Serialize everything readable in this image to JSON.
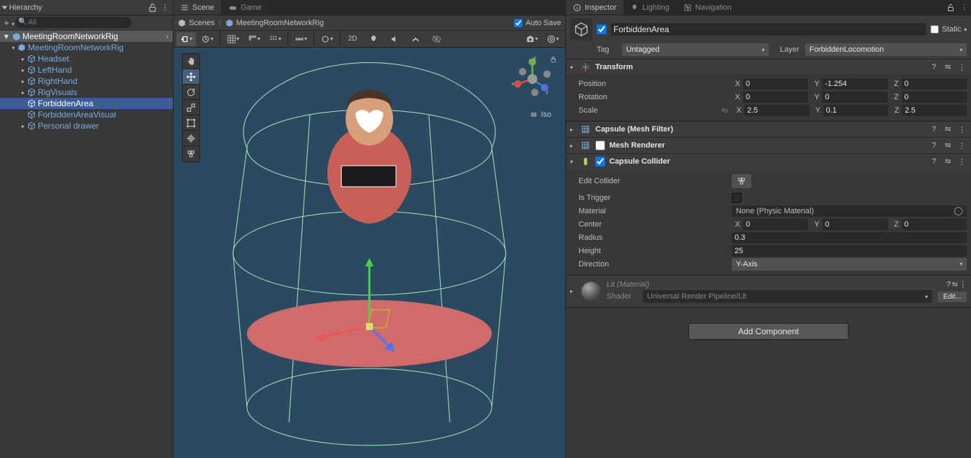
{
  "hierarchy": {
    "title": "Hierarchy",
    "search_placeholder": "All",
    "scene_name": "MeetingRoomNetworkRig",
    "root": "MeetingRoomNetworkRig",
    "nodes": {
      "headset": "Headset",
      "lefthand": "LeftHand",
      "righthand": "RightHand",
      "rigvisuals": "RigVisuals",
      "forbiddenarea": "ForbiddenArea",
      "forbiddenareavisual": "ForbiddenAreaVisual",
      "personaldrawer": "Personal drawer"
    }
  },
  "scene": {
    "tab_scene": "Scene",
    "tab_game": "Game",
    "bc_scenes": "Scenes",
    "bc_item": "MeetingRoomNetworkRig",
    "autosave": "Auto Save",
    "iso": "Iso",
    "twod": "2D",
    "axes": {
      "x": "x",
      "y": "y",
      "z": "z"
    }
  },
  "inspector": {
    "tab_inspector": "Inspector",
    "tab_lighting": "Lighting",
    "tab_navigation": "Navigation",
    "obj_name": "ForbiddenArea",
    "static_label": "Static",
    "tag_label": "Tag",
    "tag_value": "Untagged",
    "layer_label": "Layer",
    "layer_value": "ForbiddenLocomotion",
    "transform": {
      "title": "Transform",
      "position": "Position",
      "rotation": "Rotation",
      "scale": "Scale",
      "pos": {
        "x": "0",
        "y": "-1.254",
        "z": "0"
      },
      "rot": {
        "x": "0",
        "y": "0",
        "z": "0"
      },
      "scl": {
        "x": "2.5",
        "y": "0.1",
        "z": "2.5"
      }
    },
    "meshfilter": {
      "title": "Capsule (Mesh Filter)"
    },
    "meshrenderer": {
      "title": "Mesh Renderer"
    },
    "collider": {
      "title": "Capsule Collider",
      "edit_label": "Edit Collider",
      "istrigger": "Is Trigger",
      "material": "Material",
      "material_value": "None (Physic Material)",
      "center": "Center",
      "center_v": {
        "x": "0",
        "y": "0",
        "z": "0"
      },
      "radius": "Radius",
      "radius_v": "0.3",
      "height": "Height",
      "height_v": "25",
      "direction": "Direction",
      "direction_v": "Y-Axis"
    },
    "material": {
      "name": "Lit (Material)",
      "shader_label": "Shader",
      "shader_value": "Universal Render Pipeline/Lit",
      "edit": "Edit..."
    },
    "add_component": "Add Component",
    "axis": {
      "x": "X",
      "y": "Y",
      "z": "Z"
    }
  }
}
